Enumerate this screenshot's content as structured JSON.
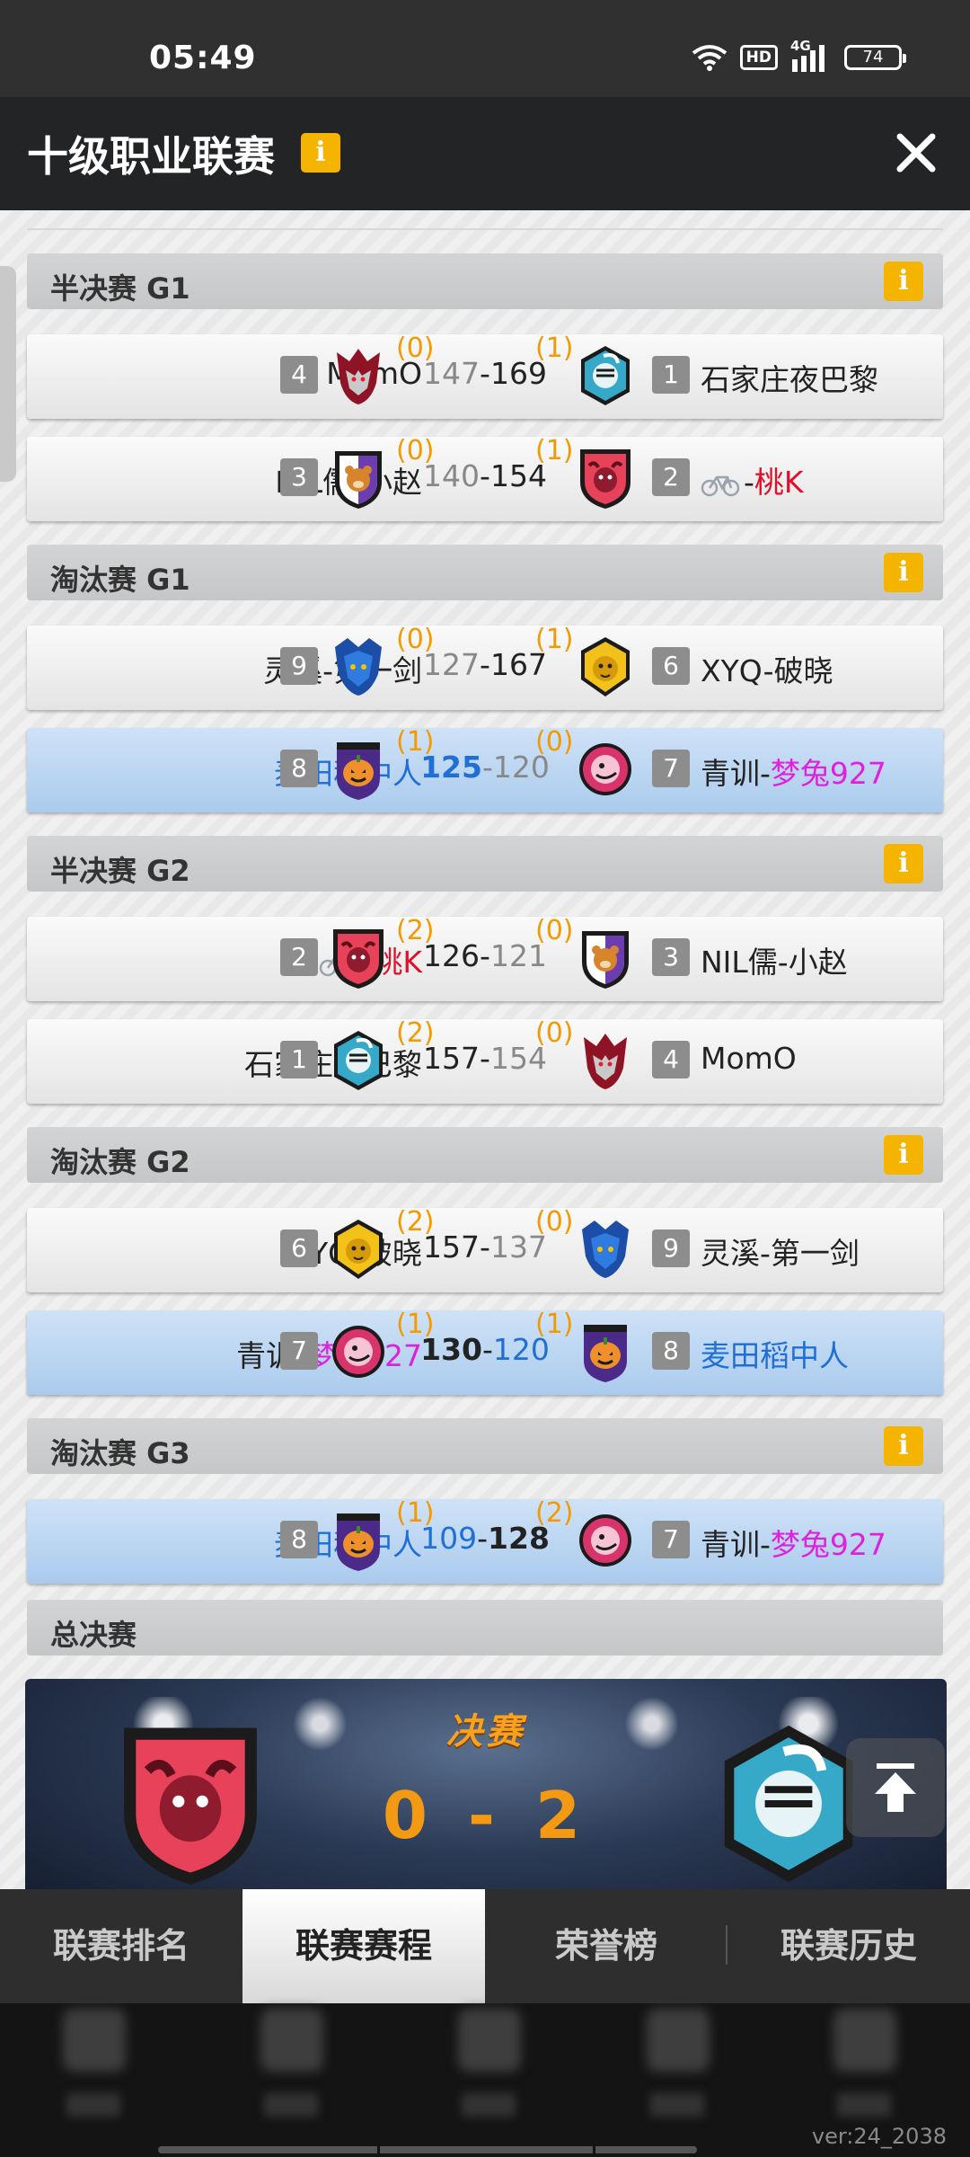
{
  "status_bar": {
    "time": "05:49",
    "network": "4G",
    "hd": "HD",
    "battery": "74"
  },
  "header": {
    "title": "十级职业联赛"
  },
  "sections": [
    {
      "label": "半决赛 G1"
    },
    {
      "label": "淘汰赛 G1"
    },
    {
      "label": "半决赛 G2"
    },
    {
      "label": "淘汰赛 G2"
    },
    {
      "label": "淘汰赛 G3"
    },
    {
      "label": "总决赛"
    }
  ],
  "matches": [
    {
      "left_name": "MomO",
      "left_seed": "4",
      "left_wins": "(0)",
      "left_score": "147",
      "right_score": "169",
      "right_wins": "(1)",
      "right_seed": "1",
      "right_name": "石家庄夜巴黎"
    },
    {
      "left_name": "NIL儒-小赵",
      "left_seed": "3",
      "left_wins": "(0)",
      "left_score": "140",
      "right_score": "154",
      "right_wins": "(1)",
      "right_seed": "2",
      "right_name_prefix": "-",
      "right_name_colored": "桃K"
    },
    {
      "left_name": "灵溪-第一剑",
      "left_seed": "9",
      "left_wins": "(0)",
      "left_score": "127",
      "right_score": "167",
      "right_wins": "(1)",
      "right_seed": "6",
      "right_name": "XYQ-破晓"
    },
    {
      "left_name": "麦田稻中人",
      "left_seed": "8",
      "left_wins": "(1)",
      "left_score": "125",
      "right_score": "120",
      "right_wins": "(0)",
      "right_seed": "7",
      "right_name_prefix": "青训-",
      "right_name_colored": "梦兔927"
    },
    {
      "left_name_prefix": "-",
      "left_name_colored": "桃K",
      "left_seed": "2",
      "left_wins": "(2)",
      "left_score": "126",
      "right_score": "121",
      "right_wins": "(0)",
      "right_seed": "3",
      "right_name": "NIL儒-小赵"
    },
    {
      "left_name": "石家庄夜巴黎",
      "left_seed": "1",
      "left_wins": "(2)",
      "left_score": "157",
      "right_score": "154",
      "right_wins": "(0)",
      "right_seed": "4",
      "right_name": "MomO"
    },
    {
      "left_name": "XYQ-破晓",
      "left_seed": "6",
      "left_wins": "(2)",
      "left_score": "157",
      "right_score": "137",
      "right_wins": "(0)",
      "right_seed": "9",
      "right_name": "灵溪-第一剑"
    },
    {
      "left_name_prefix": "青训-",
      "left_name_colored": "梦兔927",
      "left_seed": "7",
      "left_wins": "(1)",
      "left_score": "130",
      "right_score": "120",
      "right_wins": "(1)",
      "right_seed": "8",
      "right_name": "麦田稻中人"
    },
    {
      "left_name": "麦田稻中人",
      "left_seed": "8",
      "left_wins": "(1)",
      "left_score": "109",
      "right_score": "128",
      "right_wins": "(2)",
      "right_seed": "7",
      "right_name_prefix": "青训-",
      "right_name_colored": "梦兔927"
    }
  ],
  "final": {
    "title": "决赛",
    "score": "0 - 2"
  },
  "tabs": [
    {
      "label": "联赛排名"
    },
    {
      "label": "联赛赛程"
    },
    {
      "label": "荣誉榜"
    },
    {
      "label": "联赛历史"
    }
  ],
  "footer": {
    "version": "ver:24_2038"
  },
  "colors": {
    "accent": "#f5b400",
    "wins": "#f29a00",
    "blue_team": "#1f6fd6",
    "magenta": "#dd22dd",
    "red": "#e0102a",
    "highlight_row": "#b8d4f2"
  },
  "icons": [
    "wifi-icon",
    "signal-icon",
    "info-icon",
    "close-icon",
    "bison-crest-icon",
    "knight-crest-icon",
    "wolf-crest-icon",
    "bear-crest-icon",
    "dragon-crest-icon",
    "lion-crest-icon",
    "pumpkin-crest-icon",
    "dino-crest-icon",
    "bike-icon",
    "scroll-top-icon"
  ]
}
